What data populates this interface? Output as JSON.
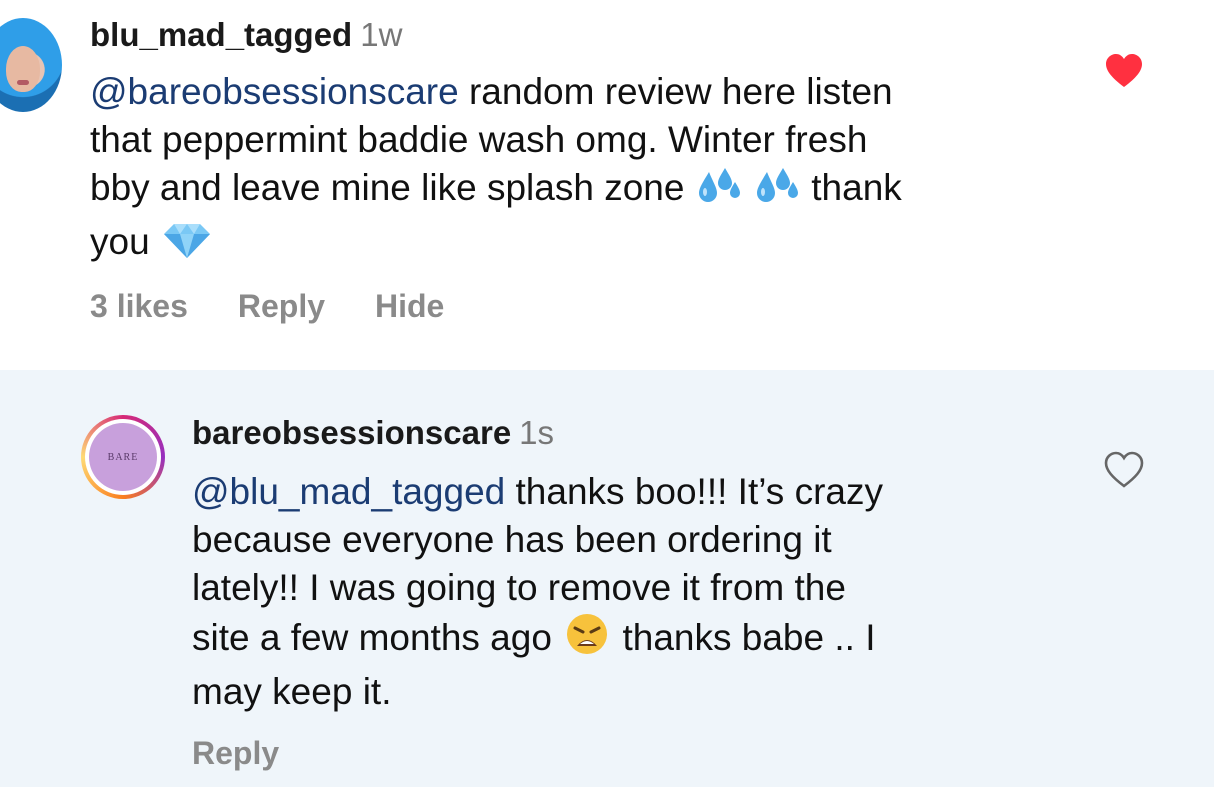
{
  "comments": [
    {
      "username": "blu_mad_tagged",
      "time": "1w",
      "mention": "@bareobsessionscare",
      "text_line1": " random review here listen",
      "text_line2": "that peppermint baddie wash omg. Winter fresh",
      "text_line3a": "bby and leave mine like splash zone ",
      "text_line3b": " thank",
      "text_line4": "you ",
      "likes": "3 likes",
      "reply_label": "Reply",
      "hide_label": "Hide",
      "liked": true,
      "emojis": [
        "sweat-droplets-emoji",
        "sweat-droplets-emoji",
        "gem-stone-emoji"
      ]
    },
    {
      "username": "bareobsessionscare",
      "time": "1s",
      "avatar_text": "BARE",
      "mention": "@blu_mad_tagged",
      "text_line1": " thanks boo!!! It’s crazy",
      "text_line2": "because everyone has been ordering it",
      "text_line3": "lately!! I was going to remove it from the",
      "text_line4a": "site a few months ago ",
      "text_line4b": " thanks babe .. I",
      "text_line5": "may keep it.",
      "reply_label": "Reply",
      "liked": false,
      "emojis": [
        "weary-face-emoji"
      ]
    }
  ],
  "colors": {
    "mention": "#1b3c73",
    "heart_liked": "#ff3040",
    "reply_background": "#eff5fa",
    "action_text": "#8a8a8a"
  }
}
